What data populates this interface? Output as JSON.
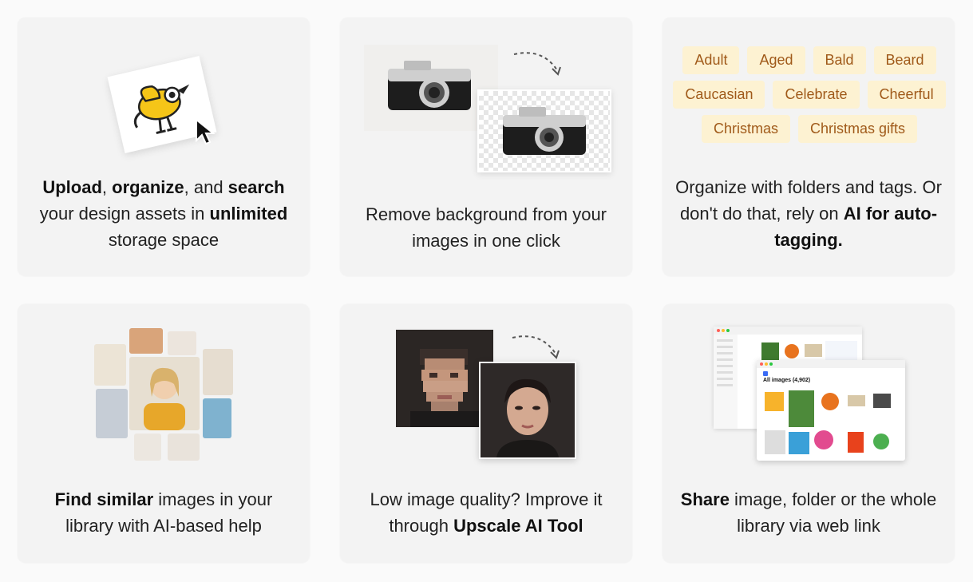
{
  "features": [
    {
      "caption": [
        {
          "text": "Upload",
          "bold": true
        },
        {
          "text": ", ",
          "bold": false
        },
        {
          "text": "organize",
          "bold": true
        },
        {
          "text": ", and ",
          "bold": false
        },
        {
          "text": "search",
          "bold": true
        },
        {
          "text": " your design assets in ",
          "bold": false
        },
        {
          "text": "unlimited",
          "bold": true
        },
        {
          "text": " storage space",
          "bold": false
        }
      ]
    },
    {
      "caption": [
        {
          "text": "Remove background from your images in one click",
          "bold": false
        }
      ]
    },
    {
      "tags": [
        [
          "Adult",
          "Aged",
          "Bald",
          "Beard"
        ],
        [
          "Caucasian",
          "Celebrate",
          "Cheerful"
        ],
        [
          "Christmas",
          "Christmas gifts"
        ]
      ],
      "caption": [
        {
          "text": "Organize with folders and tags. Or don't do that, rely on ",
          "bold": false
        },
        {
          "text": "AI for auto-tagging.",
          "bold": true
        }
      ]
    },
    {
      "caption": [
        {
          "text": "Find similar",
          "bold": true
        },
        {
          "text": " images in your library with AI-based help",
          "bold": false
        }
      ]
    },
    {
      "caption": [
        {
          "text": "Low image quality? Improve it through ",
          "bold": false
        },
        {
          "text": "Upscale AI Tool",
          "bold": true
        }
      ]
    },
    {
      "app_window_title": "All images (4,902)",
      "caption": [
        {
          "text": "Share",
          "bold": true
        },
        {
          "text": " image, folder or the whole library via web link",
          "bold": false
        }
      ]
    }
  ],
  "colors": {
    "card_bg": "#f3f3f3",
    "tag_bg": "#fdf2d2",
    "tag_text": "#a05a1a"
  }
}
